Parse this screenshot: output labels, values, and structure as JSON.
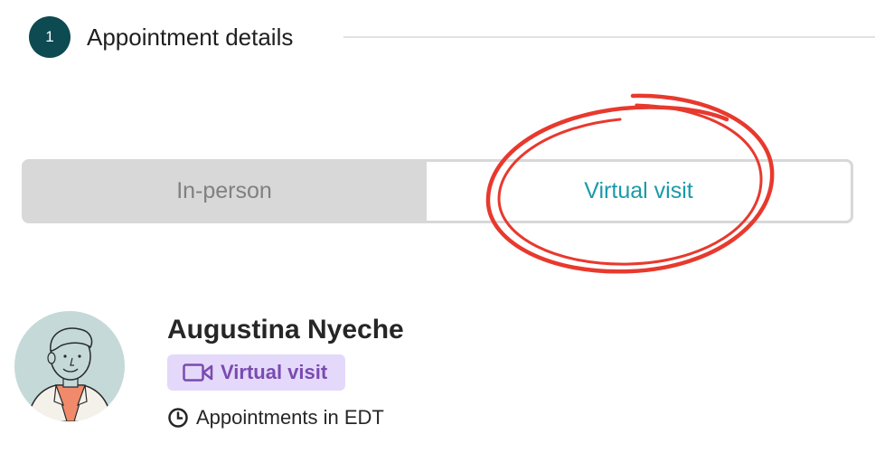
{
  "step": {
    "number": "1",
    "title": "Appointment details"
  },
  "visit_type_toggle": {
    "options": [
      {
        "label": "In-person",
        "selected": false
      },
      {
        "label": "Virtual visit",
        "selected": true
      }
    ]
  },
  "annotation": {
    "type": "hand-drawn circle",
    "color": "#e8392e",
    "target": "Virtual visit"
  },
  "provider": {
    "name": "Augustina Nyeche",
    "visit_badge": "Virtual visit",
    "timezone_note": "Appointments in EDT",
    "icons": [
      "video-camera-icon",
      "clock-icon"
    ]
  },
  "colors": {
    "step_circle": "#0d4a52",
    "selected_text": "#1a9aa8",
    "badge_bg": "#e4d9fb",
    "badge_text": "#7a4bb0",
    "toggle_bg": "#d8d8d8"
  }
}
